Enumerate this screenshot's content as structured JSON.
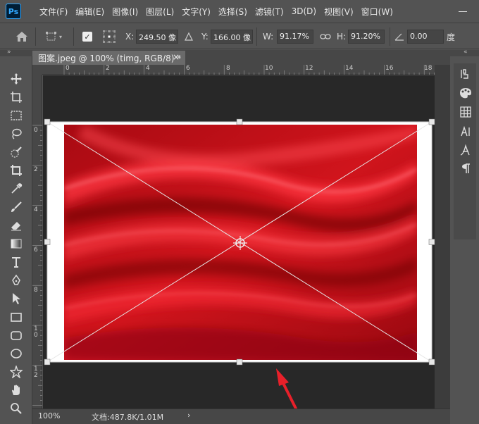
{
  "app": {
    "logo": "Ps"
  },
  "menu": [
    "文件(F)",
    "编辑(E)",
    "图像(I)",
    "图层(L)",
    "文字(Y)",
    "选择(S)",
    "滤镜(T)",
    "3D(D)",
    "视图(V)",
    "窗口(W)"
  ],
  "options": {
    "x_label": "X:",
    "x_value": "249.50 像",
    "y_label": "Y:",
    "y_value": "166.00 像",
    "w_label": "W:",
    "w_value": "91.17%",
    "h_label": "H:",
    "h_value": "91.20%",
    "angle_value": "0.00",
    "angle_unit": "度"
  },
  "document": {
    "tab_title": "图案.jpeg @ 100% (timg, RGB/8) *",
    "close": "×"
  },
  "ruler_h": [
    "0",
    "2",
    "4",
    "6",
    "8",
    "10",
    "12",
    "14",
    "16",
    "18"
  ],
  "ruler_v": [
    "0",
    "2",
    "4",
    "6",
    "8",
    "1 0",
    "1 2"
  ],
  "status": {
    "zoom": "100%",
    "doc": "文档:487.8K/1.01M",
    "arrow": "›"
  },
  "colors": {
    "fabric": "#c8111a",
    "arrow": "#e8202a",
    "canvas": "#282828"
  },
  "tools": [
    "move-icon",
    "artboard-icon",
    "marquee-icon",
    "lasso-icon",
    "quick-select-icon",
    "crop-icon",
    "eyedropper-icon",
    "brush-icon",
    "eraser-icon",
    "gradient-icon",
    "type-icon",
    "pen-icon",
    "path-select-icon",
    "rectangle-icon",
    "rounded-rect-icon",
    "ellipse-icon",
    "custom-shape-icon",
    "hand-icon",
    "zoom-icon"
  ],
  "right_panel": [
    "history-icon",
    "color-icon",
    "swatches-icon",
    "character-icon",
    "glyphs-icon",
    "paragraph-icon"
  ]
}
